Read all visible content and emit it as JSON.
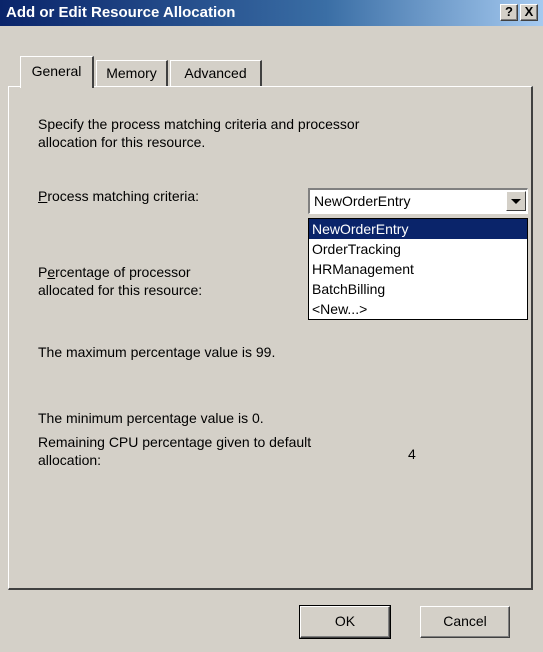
{
  "window": {
    "title": "Add or Edit Resource Allocation",
    "help_label": "?",
    "close_label": "X"
  },
  "tabs": [
    {
      "label": "General",
      "active": true
    },
    {
      "label": "Memory",
      "active": false
    },
    {
      "label": "Advanced",
      "active": false
    }
  ],
  "general": {
    "description_line1": "Specify the process matching criteria and processor",
    "description_line2": "allocation for this resource.",
    "criteria_label": "Process matching criteria:",
    "percentage_label_line1": "Percentage of processor",
    "percentage_label_line2": "allocated for this resource:",
    "max_text": "The maximum percentage value is 99.",
    "min_text": "The minimum percentage value is 0.",
    "remaining_label_line1": "Remaining CPU percentage given to default",
    "remaining_label_line2": "allocation:",
    "remaining_value": "4"
  },
  "combo": {
    "selected": "NewOrderEntry",
    "options": [
      "NewOrderEntry",
      "OrderTracking",
      "HRManagement",
      "BatchBilling",
      "<New...>"
    ]
  },
  "buttons": {
    "ok_label": "OK",
    "cancel_label": "Cancel"
  }
}
